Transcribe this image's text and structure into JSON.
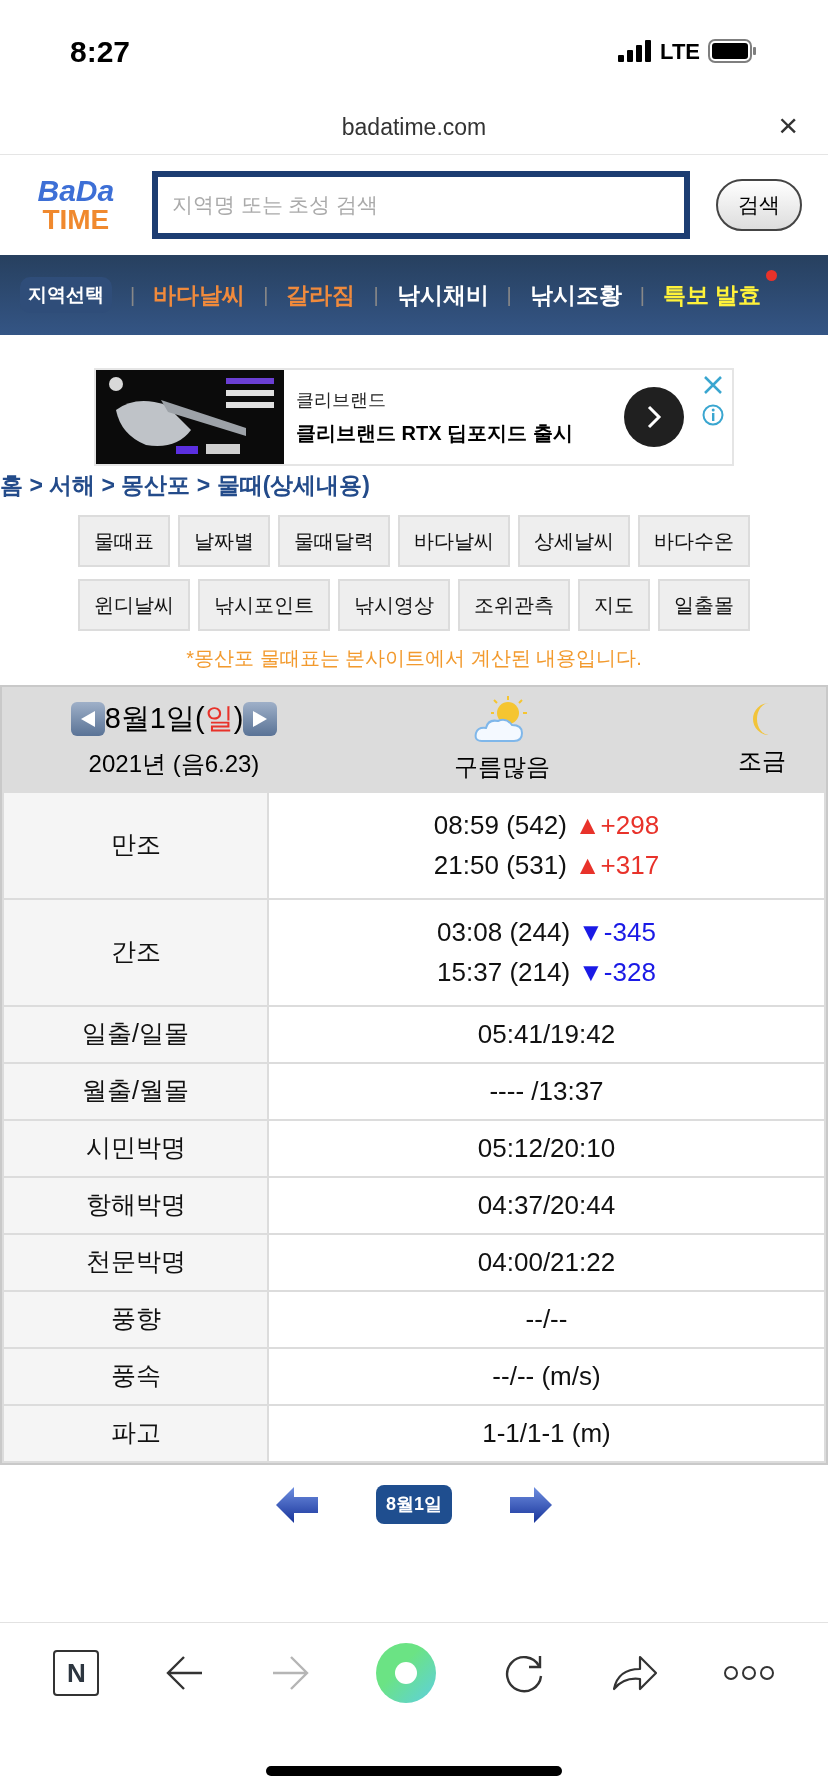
{
  "status_bar": {
    "time": "8:27",
    "network": "LTE"
  },
  "browser": {
    "url": "badatime.com",
    "close": "×"
  },
  "header": {
    "logo_top": "BaDa",
    "logo_bottom": "TIME",
    "search": {
      "placeholder": "지역명 또는 초성 검색"
    },
    "search_button": "검색"
  },
  "nav": {
    "region_button": "지역선택",
    "separator": "|",
    "items": [
      {
        "label": "바다날씨",
        "kind": "orange",
        "dot": false
      },
      {
        "label": "갈라짐",
        "kind": "orange",
        "dot": false
      },
      {
        "label": "낚시채비",
        "kind": "white",
        "dot": false
      },
      {
        "label": "낚시조황",
        "kind": "white",
        "dot": false
      },
      {
        "label": "특보 발효",
        "kind": "yellow",
        "dot": true
      }
    ]
  },
  "ad": {
    "advertiser": "클리브랜드",
    "headline": "클리브랜드 RTX 딥포지드 출시"
  },
  "breadcrumb": "홈 > 서해 > 몽산포 > 물때(상세내용)",
  "menu_rows": [
    [
      "물때표",
      "날짜별",
      "물때달력",
      "바다날씨",
      "상세날씨",
      "바다수온"
    ],
    [
      "윈디날씨",
      "낚시포인트",
      "낚시영상",
      "조위관측",
      "지도",
      "일출몰"
    ]
  ],
  "notice": "*몽산포 물때표는 본사이트에서 계산된 내용입니다.",
  "day": {
    "date_prefix": "8월1일(",
    "weekday": "일",
    "date_suffix": ")",
    "year_lunar": "2021년 (음6.23)",
    "weather": "구름많음",
    "tide_phase": "조금"
  },
  "tide_rows": [
    {
      "label": "만조",
      "entries": [
        {
          "time": "08:59 (542)",
          "change": "▲+298",
          "kind": "rise"
        },
        {
          "time": "21:50 (531)",
          "change": "▲+317",
          "kind": "rise"
        }
      ]
    },
    {
      "label": "간조",
      "entries": [
        {
          "time": "03:08 (244)",
          "change": "▼-345",
          "kind": "fall"
        },
        {
          "time": "15:37 (214)",
          "change": "▼-328",
          "kind": "fall"
        }
      ]
    }
  ],
  "info_rows": [
    {
      "label": "일출/일몰",
      "value": "05:41/19:42"
    },
    {
      "label": "월출/월몰",
      "value": "---- /13:37"
    },
    {
      "label": "시민박명",
      "value": "05:12/20:10"
    },
    {
      "label": "항해박명",
      "value": "04:37/20:44"
    },
    {
      "label": "천문박명",
      "value": "04:00/21:22"
    },
    {
      "label": "풍향",
      "value": "--/--"
    },
    {
      "label": "풍속",
      "value": "--/-- (m/s)"
    },
    {
      "label": "파고",
      "value": "1-1/1-1 (m)"
    }
  ],
  "date_nav": {
    "current": "8월1일"
  },
  "toolbar": {
    "home_letter": "N"
  }
}
